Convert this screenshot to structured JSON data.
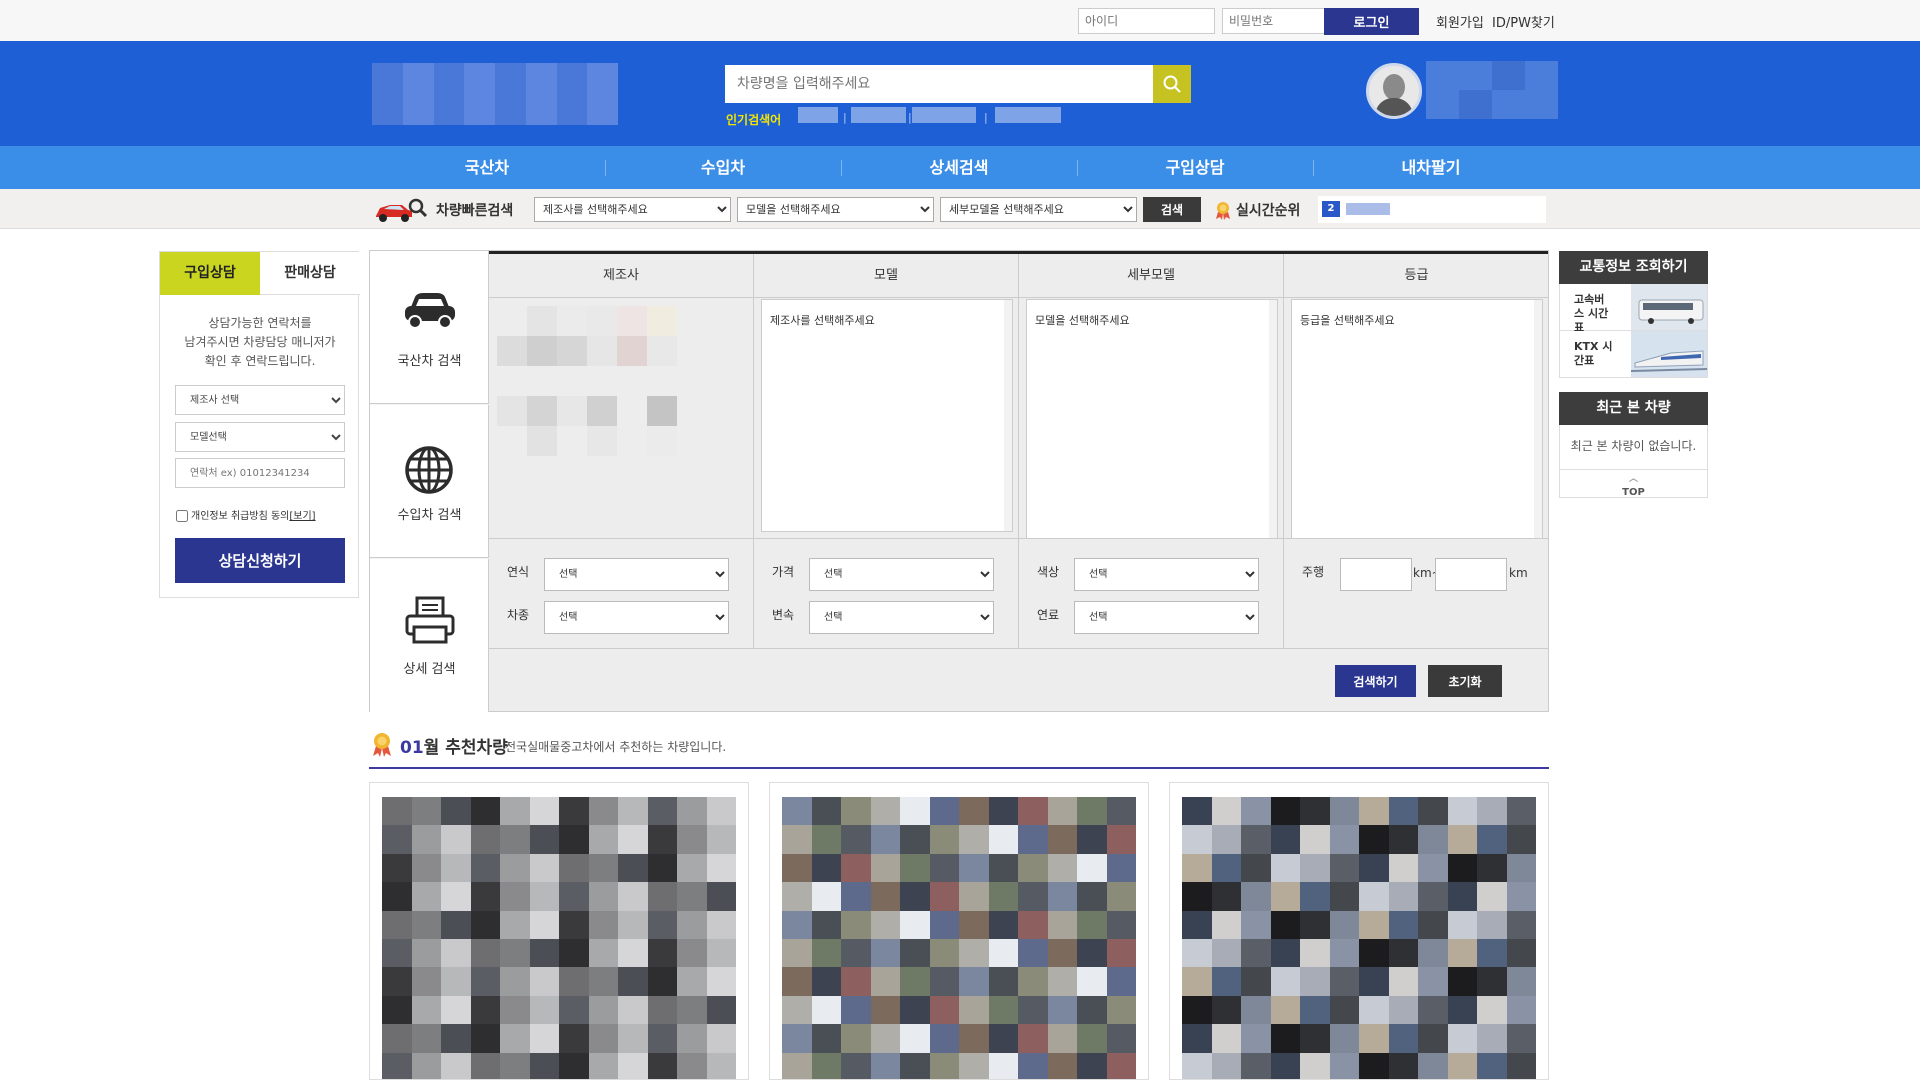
{
  "topbar": {
    "id_placeholder": "아이디",
    "pw_placeholder": "비밀번호",
    "login_label": "로그인",
    "signup_label": "회원가입",
    "find_label": "ID/PW찾기"
  },
  "header": {
    "search_placeholder": "차량명을 입력해주세요",
    "popular_label": "인기검색어"
  },
  "nav": {
    "items": [
      "국산차",
      "수입차",
      "상세검색",
      "구입상담",
      "내차팔기"
    ]
  },
  "quick_search": {
    "label": "차량빠른검색",
    "maker_select": "제조사를 선택해주세요",
    "model_select": "모델을 선택해주세요",
    "detail_select": "세부모델을 선택해주세요",
    "search_label": "검색",
    "rank_label": "실시간순위",
    "rank_number": "2"
  },
  "consult": {
    "tab_buy": "구입상담",
    "tab_sell": "판매상담",
    "desc_line1": "상담가능한 연락처를",
    "desc_line2": "남겨주시면 차량담당 매니저가",
    "desc_line3": "확인 후 연락드립니다.",
    "maker_select": "제조사 선택",
    "model_select": "모델선택",
    "phone_placeholder": "연락처 ex) 01012341234",
    "agree_label": "개인정보 취급방침 동의",
    "agree_link": "[보기]",
    "submit_label": "상담신청하기"
  },
  "search_panel": {
    "types": [
      "국산차 검색",
      "수입차 검색",
      "상세 검색"
    ],
    "columns": [
      {
        "header": "제조사",
        "placeholder": ""
      },
      {
        "header": "모델",
        "placeholder": "제조사를 선택해주세요"
      },
      {
        "header": "세부모델",
        "placeholder": "모델을 선택해주세요"
      },
      {
        "header": "등급",
        "placeholder": "등급을 선택해주세요"
      }
    ],
    "filters": {
      "year_label": "연식",
      "year_value": "선택",
      "type_label": "차종",
      "type_value": "선택",
      "price_label": "가격",
      "price_value": "선택",
      "trans_label": "변속",
      "trans_value": "선택",
      "color_label": "색상",
      "color_value": "선택",
      "fuel_label": "연료",
      "fuel_value": "선택",
      "mileage_label": "주행",
      "km_mid": "km~",
      "km_end": "km"
    },
    "search_button": "검색하기",
    "reset_button": "초기화"
  },
  "sidebar": {
    "traffic_title": "교통정보 조회하기",
    "bus_label": "고속버스 시간표",
    "ktx_label": "KTX 시간표",
    "recent_title": "최근 본 차량",
    "recent_empty": "최근 본 차량이 없습니다.",
    "top_label": "TOP"
  },
  "recommend": {
    "month": "01",
    "title_suffix": "월 추천차량",
    "subtitle": "전국실매물중고차에서 추천하는 차량입니다."
  },
  "colors": {
    "header_blue": "#1f5fd6",
    "nav_blue": "#3b8ee8",
    "accent_navy": "#2b3690",
    "accent_lime": "#c9d51f"
  }
}
